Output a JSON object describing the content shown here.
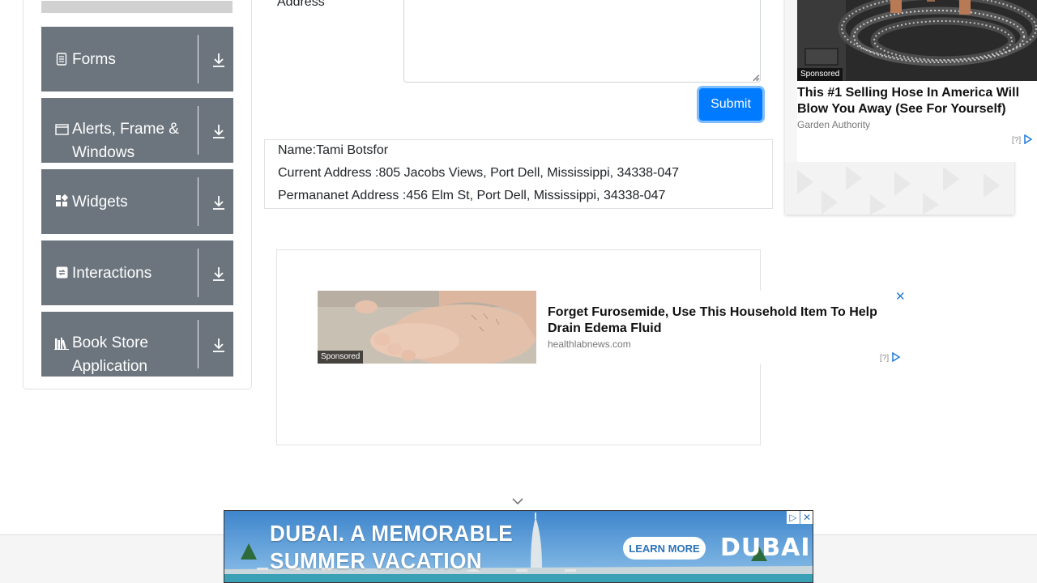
{
  "sidebar": {
    "items": [
      {
        "label": "Forms",
        "icon": "document-icon"
      },
      {
        "label": "Alerts, Frame & Windows",
        "icon": "window-icon"
      },
      {
        "label": "Widgets",
        "icon": "widgets-icon"
      },
      {
        "label": "Interactions",
        "icon": "interactions-icon"
      },
      {
        "label": "Book Store Application",
        "icon": "books-icon"
      }
    ]
  },
  "form": {
    "address_label": "Address",
    "address_value": "",
    "submit_label": "Submit"
  },
  "output": {
    "name": "Name:Tami Botsfor",
    "current_address": "Current Address :805 Jacobs Views, Port Dell, Mississippi, 34338-047",
    "permanent_address": "Permananet Address :456 Elm St, Port Dell, Mississippi, 34338-047"
  },
  "ads": {
    "center": {
      "sponsored": "Sponsored",
      "title": "Forget Furosemide, Use This Household Item To Help Drain Edema Fluid",
      "source": "healthlabnews.com",
      "info": "[?]",
      "close": "✕"
    },
    "right": {
      "sponsored": "Sponsored",
      "title": "This #1 Selling Hose In America Will Blow You Away (See For Yourself)",
      "source": "Garden Authority",
      "info": "[?]"
    },
    "banner": {
      "line1": "DUBAI. A MEMORABLE",
      "line2": "SUMMER VACATION",
      "cta": "LEARN MORE",
      "logo": "DUBAI"
    }
  },
  "colors": {
    "sidebar_item_bg": "#6c757d",
    "submit_bg": "#007bff",
    "banner_sky": "#4b8fd0"
  }
}
